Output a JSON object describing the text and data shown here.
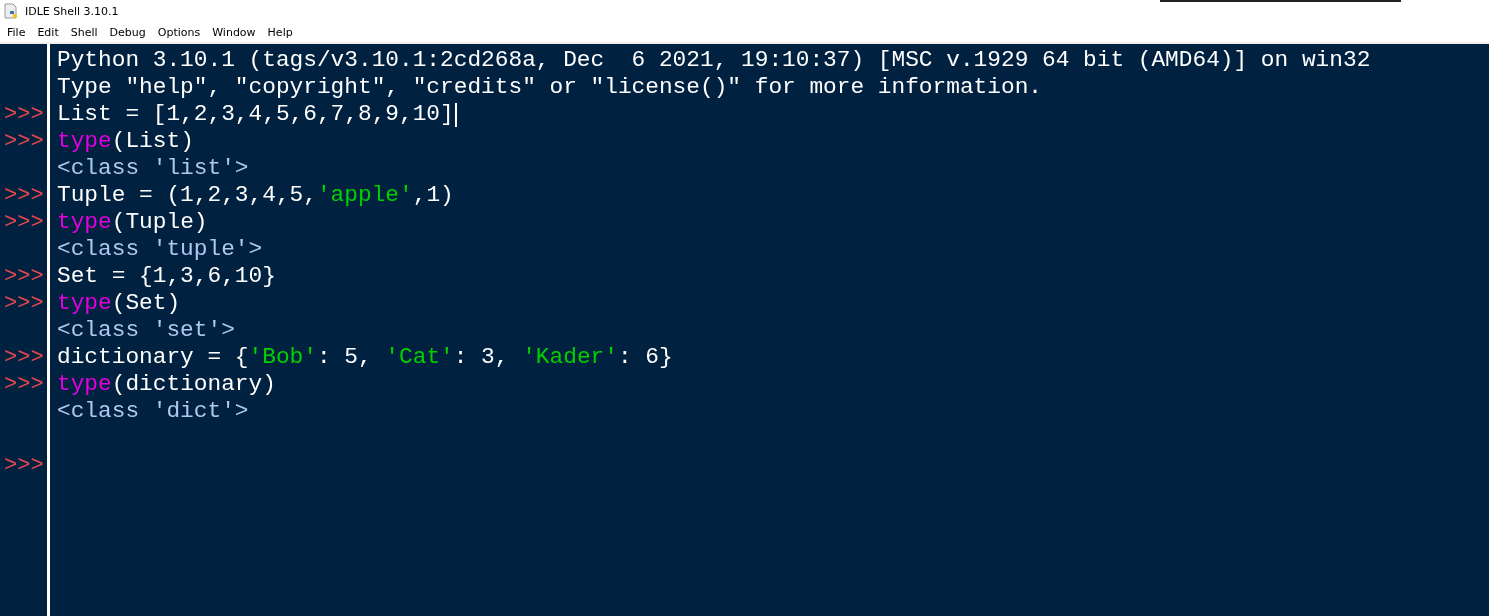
{
  "window": {
    "title": "IDLE Shell 3.10.1"
  },
  "menu": [
    "File",
    "Edit",
    "Shell",
    "Debug",
    "Options",
    "Window",
    "Help"
  ],
  "lines": [
    {
      "segments": [
        {
          "kind": "output",
          "text": "Python 3.10.1 (tags/v3.10.1:2cd268a, Dec  6 2021, 19:10:37) [MSC v.1929 64 bit (AMD64)] on win32"
        }
      ]
    },
    {
      "segments": [
        {
          "kind": "output",
          "text": "Type \"help\", \"copyright\", \"credits\" or \"license()\" for more information."
        }
      ]
    },
    {
      "prompt": ">>>",
      "cursor": true,
      "segments": [
        {
          "kind": "code",
          "text": "List = [1,2,3,4,5,6,7,8,9,10]"
        }
      ]
    },
    {
      "prompt": ">>>",
      "segments": [
        {
          "kind": "keyword",
          "text": "type"
        },
        {
          "kind": "code",
          "text": "(List)"
        }
      ]
    },
    {
      "segments": [
        {
          "kind": "result",
          "text": "<class 'list'>"
        }
      ]
    },
    {
      "prompt": ">>>",
      "segments": [
        {
          "kind": "code",
          "text": "Tuple = (1,2,3,4,5,"
        },
        {
          "kind": "string",
          "text": "'apple'"
        },
        {
          "kind": "code",
          "text": ",1)"
        }
      ]
    },
    {
      "prompt": ">>>",
      "segments": [
        {
          "kind": "keyword",
          "text": "type"
        },
        {
          "kind": "code",
          "text": "(Tuple)"
        }
      ]
    },
    {
      "segments": [
        {
          "kind": "result",
          "text": "<class 'tuple'>"
        }
      ]
    },
    {
      "prompt": ">>>",
      "segments": [
        {
          "kind": "code",
          "text": "Set = {1,3,6,10}"
        }
      ]
    },
    {
      "prompt": ">>>",
      "segments": [
        {
          "kind": "keyword",
          "text": "type"
        },
        {
          "kind": "code",
          "text": "(Set)"
        }
      ]
    },
    {
      "segments": [
        {
          "kind": "result",
          "text": "<class 'set'>"
        }
      ]
    },
    {
      "prompt": ">>>",
      "segments": [
        {
          "kind": "code",
          "text": "dictionary = {"
        },
        {
          "kind": "string",
          "text": "'Bob'"
        },
        {
          "kind": "code",
          "text": ": 5, "
        },
        {
          "kind": "string",
          "text": "'Cat'"
        },
        {
          "kind": "code",
          "text": ": 3, "
        },
        {
          "kind": "string",
          "text": "'Kader'"
        },
        {
          "kind": "code",
          "text": ": 6}"
        }
      ]
    },
    {
      "prompt": ">>>",
      "segments": [
        {
          "kind": "keyword",
          "text": "type"
        },
        {
          "kind": "code",
          "text": "(dictionary)"
        }
      ]
    },
    {
      "segments": [
        {
          "kind": "result",
          "text": "<class 'dict'>"
        }
      ]
    },
    {
      "prompt": ">>>",
      "blank_line_before": true
    }
  ]
}
